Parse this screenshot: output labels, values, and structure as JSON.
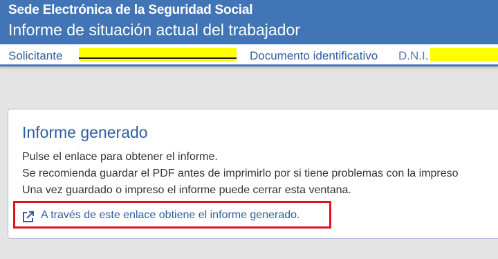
{
  "header": {
    "org": "Sede Electrónica de la Seguridad Social",
    "title": "Informe de situación actual del trabajador"
  },
  "infobar": {
    "applicant_label": "Solicitante",
    "applicant_value": "[redacted]",
    "document_label": "Documento identificativo",
    "document_type": "D.N.I.",
    "document_value": "[redacted]"
  },
  "card": {
    "title": "Informe generado",
    "lines": [
      "Pulse el enlace para obtener el informe.",
      "Se recomienda guardar el PDF antes de imprimirlo por si tiene problemas con la impreso",
      "Una vez guardado o impreso el informe puede cerrar esta ventana."
    ],
    "link_label": "A través de este enlace obtiene el informe generado.",
    "link_icon": "external-link-icon"
  },
  "colors": {
    "brand": "#4175b5",
    "link": "#2f5e9c",
    "highlight": "#e0141e",
    "redaction": "#ffff00"
  }
}
